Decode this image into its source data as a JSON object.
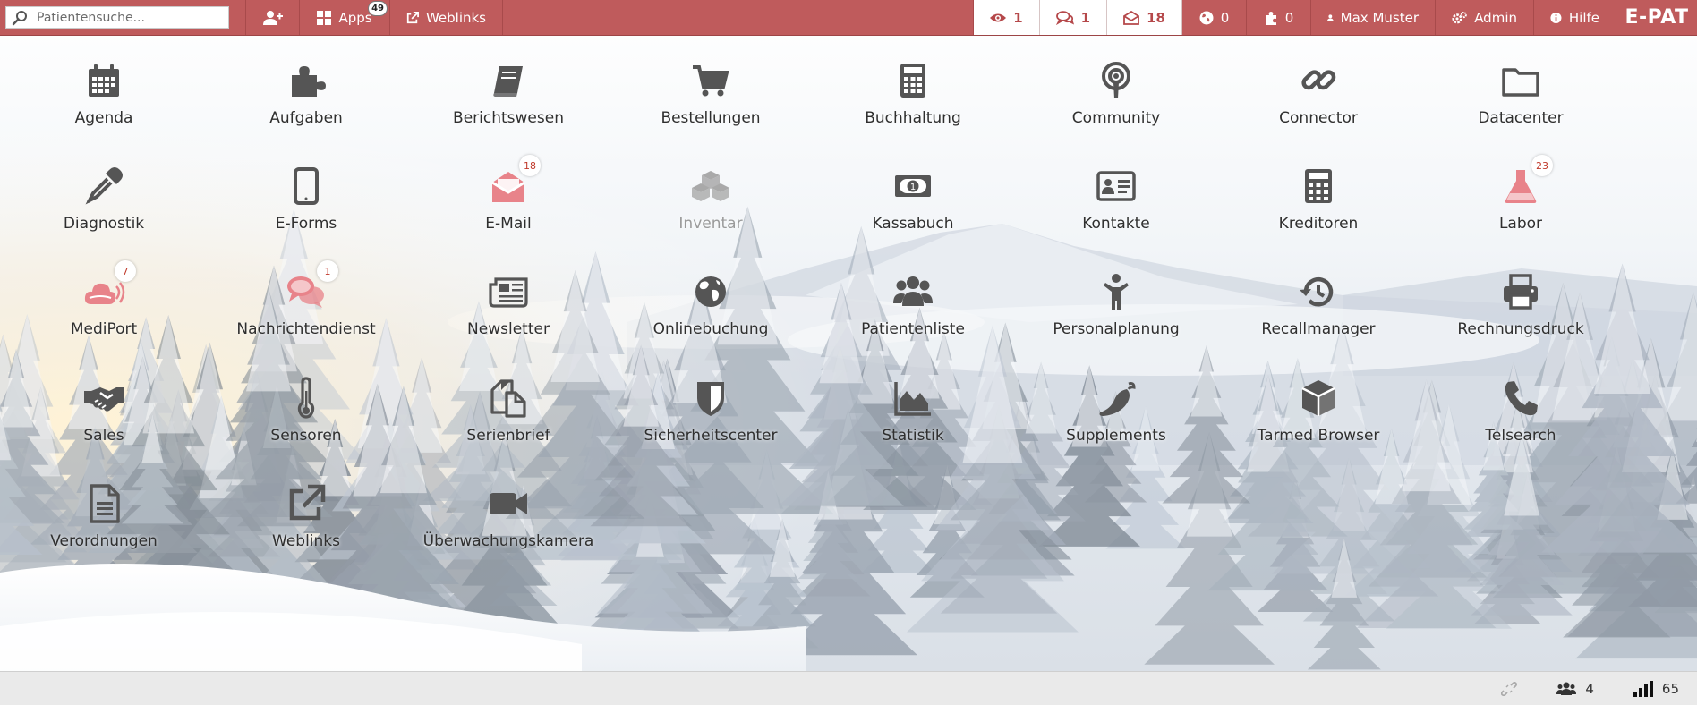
{
  "colors": {
    "accent": "#bf5b5c",
    "icon": "#555555",
    "icon_notify": "#e8838a",
    "icon_disabled": "#a9a9a9",
    "badge_text": "#c0392b"
  },
  "topbar": {
    "search_placeholder": "Patientensuche...",
    "add_patient_icon": "user-plus-icon",
    "apps_label": "Apps",
    "apps_badge": "49",
    "weblinks_label": "Weblinks",
    "views_count": "1",
    "chat_count": "1",
    "mail_count": "18",
    "globe_count": "0",
    "plugins_count": "0",
    "user_label": "Max Muster",
    "admin_label": "Admin",
    "help_label": "Hilfe",
    "brand": "E-PAT"
  },
  "apps": [
    {
      "label": "Agenda",
      "icon": "calendar-icon",
      "state": "normal",
      "badge": ""
    },
    {
      "label": "Aufgaben",
      "icon": "puzzle-icon",
      "state": "normal",
      "badge": ""
    },
    {
      "label": "Berichtswesen",
      "icon": "book-icon",
      "state": "normal",
      "badge": ""
    },
    {
      "label": "Bestellungen",
      "icon": "cart-icon",
      "state": "normal",
      "badge": ""
    },
    {
      "label": "Buchhaltung",
      "icon": "calculator-icon",
      "state": "normal",
      "badge": ""
    },
    {
      "label": "Community",
      "icon": "podcast-icon",
      "state": "normal",
      "badge": ""
    },
    {
      "label": "Connector",
      "icon": "link-icon",
      "state": "normal",
      "badge": ""
    },
    {
      "label": "Datacenter",
      "icon": "folder-icon",
      "state": "normal",
      "badge": ""
    },
    {
      "label": "Diagnostik",
      "icon": "eyedropper-icon",
      "state": "normal",
      "badge": ""
    },
    {
      "label": "E-Forms",
      "icon": "tablet-icon",
      "state": "normal",
      "badge": ""
    },
    {
      "label": "E-Mail",
      "icon": "envelope-open-icon",
      "state": "notify",
      "badge": "18"
    },
    {
      "label": "Inventar",
      "icon": "cubes-icon",
      "state": "disabled",
      "badge": ""
    },
    {
      "label": "Kassabuch",
      "icon": "money-icon",
      "state": "normal",
      "badge": ""
    },
    {
      "label": "Kontakte",
      "icon": "address-card-icon",
      "state": "normal",
      "badge": ""
    },
    {
      "label": "Kreditoren",
      "icon": "calculator-grid-icon",
      "state": "normal",
      "badge": ""
    },
    {
      "label": "Labor",
      "icon": "flask-icon",
      "state": "notify",
      "badge": "23"
    },
    {
      "label": "MediPort",
      "icon": "cloud-signal-icon",
      "state": "notify",
      "badge": "7"
    },
    {
      "label": "Nachrichtendienst",
      "icon": "comments-icon",
      "state": "notify",
      "badge": "1"
    },
    {
      "label": "Newsletter",
      "icon": "newspaper-icon",
      "state": "normal",
      "badge": ""
    },
    {
      "label": "Onlinebuchung",
      "icon": "globe-icon",
      "state": "normal",
      "badge": ""
    },
    {
      "label": "Patientenliste",
      "icon": "users-icon",
      "state": "normal",
      "badge": ""
    },
    {
      "label": "Personalplanung",
      "icon": "child-icon",
      "state": "normal",
      "badge": ""
    },
    {
      "label": "Recallmanager",
      "icon": "history-icon",
      "state": "normal",
      "badge": ""
    },
    {
      "label": "Rechnungsdruck",
      "icon": "print-icon",
      "state": "normal",
      "badge": ""
    },
    {
      "label": "Sales",
      "icon": "handshake-icon",
      "state": "normal",
      "badge": ""
    },
    {
      "label": "Sensoren",
      "icon": "thermometer-icon",
      "state": "normal",
      "badge": ""
    },
    {
      "label": "Serienbrief",
      "icon": "copy-icon",
      "state": "normal",
      "badge": ""
    },
    {
      "label": "Sicherheitscenter",
      "icon": "shield-icon",
      "state": "normal",
      "badge": ""
    },
    {
      "label": "Statistik",
      "icon": "area-chart-icon",
      "state": "normal",
      "badge": ""
    },
    {
      "label": "Supplements",
      "icon": "pepper-icon",
      "state": "normal",
      "badge": ""
    },
    {
      "label": "Tarmed Browser",
      "icon": "cube-icon",
      "state": "normal",
      "badge": ""
    },
    {
      "label": "Telsearch",
      "icon": "phone-icon",
      "state": "normal",
      "badge": ""
    },
    {
      "label": "Verordnungen",
      "icon": "file-text-icon",
      "state": "normal",
      "badge": ""
    },
    {
      "label": "Weblinks",
      "icon": "external-link-icon",
      "state": "normal",
      "badge": ""
    },
    {
      "label": "Überwachungskamera",
      "icon": "video-camera-icon",
      "state": "normal",
      "badge": ""
    }
  ],
  "statusbar": {
    "link_icon": "unlink-icon",
    "users_count": "4",
    "signal_value": "65"
  }
}
